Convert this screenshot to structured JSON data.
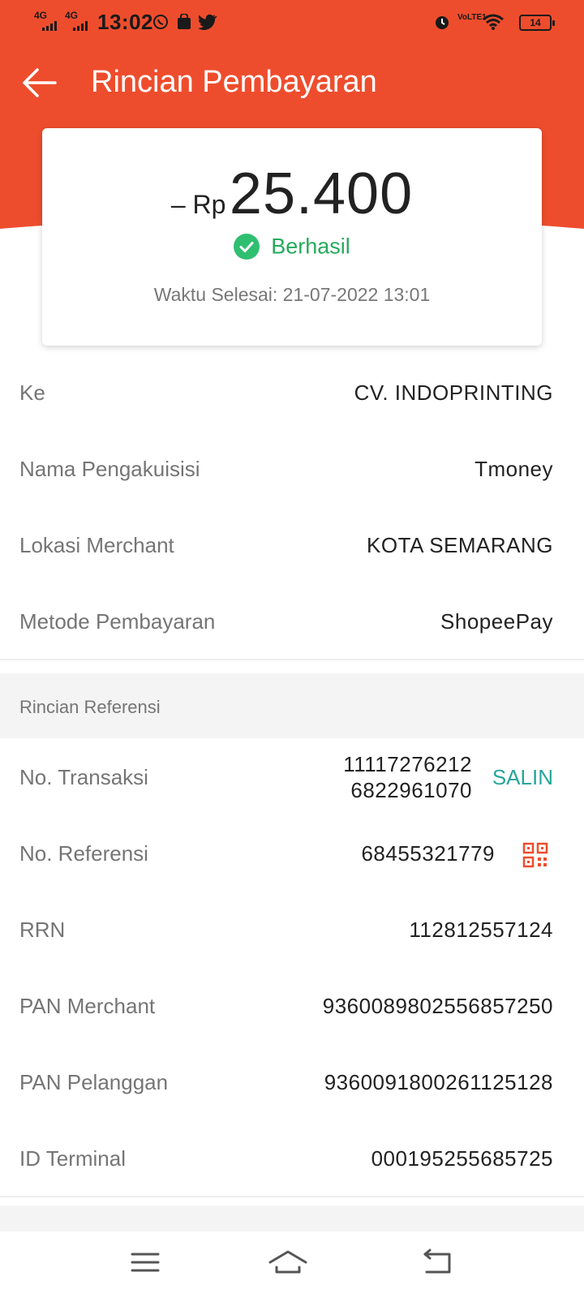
{
  "status_bar": {
    "signal_1": "4G",
    "signal_2": "4G",
    "time": "13:02",
    "volte": "VoLTE1",
    "battery": "14"
  },
  "header": {
    "title": "Rincian Pembayaran",
    "accent_color": "#ee4d2d"
  },
  "summary": {
    "amount_prefix": "– Rp",
    "amount": "25.400",
    "status": "Berhasil",
    "finish_time": "Waktu Selesai: 21-07-2022 13:01"
  },
  "details": [
    {
      "label": "Ke",
      "value": "CV. INDOPRINTING"
    },
    {
      "label": "Nama Pengakuisisi",
      "value": "Tmoney"
    },
    {
      "label": "Lokasi Merchant",
      "value": "KOTA SEMARANG"
    },
    {
      "label": "Metode Pembayaran",
      "value": "ShopeePay"
    }
  ],
  "reference": {
    "section_title": "Rincian Referensi",
    "transaction": {
      "label": "No. Transaksi",
      "value_line1": "11117276212",
      "value_line2": "6822961070",
      "copy_label": "SALIN"
    },
    "reference_no": {
      "label": "No. Referensi",
      "value": "68455321779",
      "icon": "qr-code-icon"
    },
    "rrn": {
      "label": "RRN",
      "value": "112812557124"
    },
    "pan_merchant": {
      "label": "PAN Merchant",
      "value": "9360089802556857250"
    },
    "pan_customer": {
      "label": "PAN Pelanggan",
      "value": "9360091800261125128"
    },
    "terminal": {
      "label": "ID Terminal",
      "value": "000195255685725"
    }
  },
  "nav": {
    "icons": [
      "menu-icon",
      "home-icon",
      "back-icon"
    ]
  }
}
